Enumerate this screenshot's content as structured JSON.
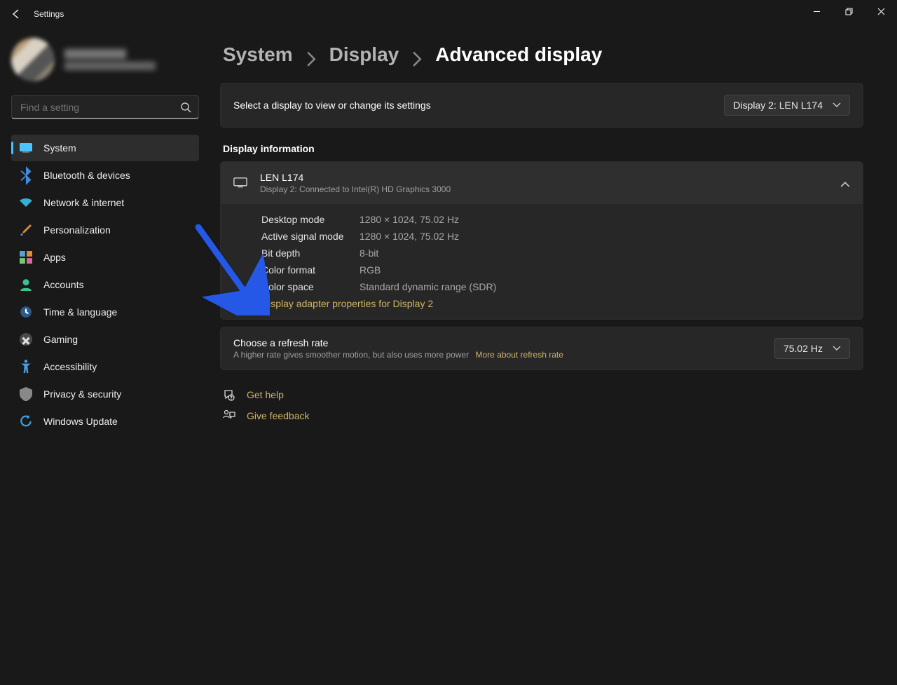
{
  "app_title": "Settings",
  "search": {
    "placeholder": "Find a setting"
  },
  "nav": {
    "items": [
      {
        "label": "System"
      },
      {
        "label": "Bluetooth & devices"
      },
      {
        "label": "Network & internet"
      },
      {
        "label": "Personalization"
      },
      {
        "label": "Apps"
      },
      {
        "label": "Accounts"
      },
      {
        "label": "Time & language"
      },
      {
        "label": "Gaming"
      },
      {
        "label": "Accessibility"
      },
      {
        "label": "Privacy & security"
      },
      {
        "label": "Windows Update"
      }
    ],
    "selected_index": 0
  },
  "breadcrumb": {
    "system": "System",
    "display": "Display",
    "advanced": "Advanced display"
  },
  "select_display": {
    "prompt": "Select a display to view or change its settings",
    "value": "Display 2: LEN L174"
  },
  "info_section_title": "Display information",
  "display_card": {
    "name": "LEN L174",
    "sub": "Display 2: Connected to Intel(R) HD Graphics 3000",
    "rows": [
      {
        "k": "Desktop mode",
        "v": "1280 × 1024, 75.02 Hz"
      },
      {
        "k": "Active signal mode",
        "v": "1280 × 1024, 75.02 Hz"
      },
      {
        "k": "Bit depth",
        "v": "8-bit"
      },
      {
        "k": "Color format",
        "v": "RGB"
      },
      {
        "k": "Color space",
        "v": "Standard dynamic range (SDR)"
      }
    ],
    "adapter_link": "Display adapter properties for Display 2"
  },
  "refresh": {
    "title": "Choose a refresh rate",
    "sub": "A higher rate gives smoother motion, but also uses more power",
    "more": "More about refresh rate",
    "value": "75.02 Hz"
  },
  "footer": {
    "help": "Get help",
    "feedback": "Give feedback"
  }
}
